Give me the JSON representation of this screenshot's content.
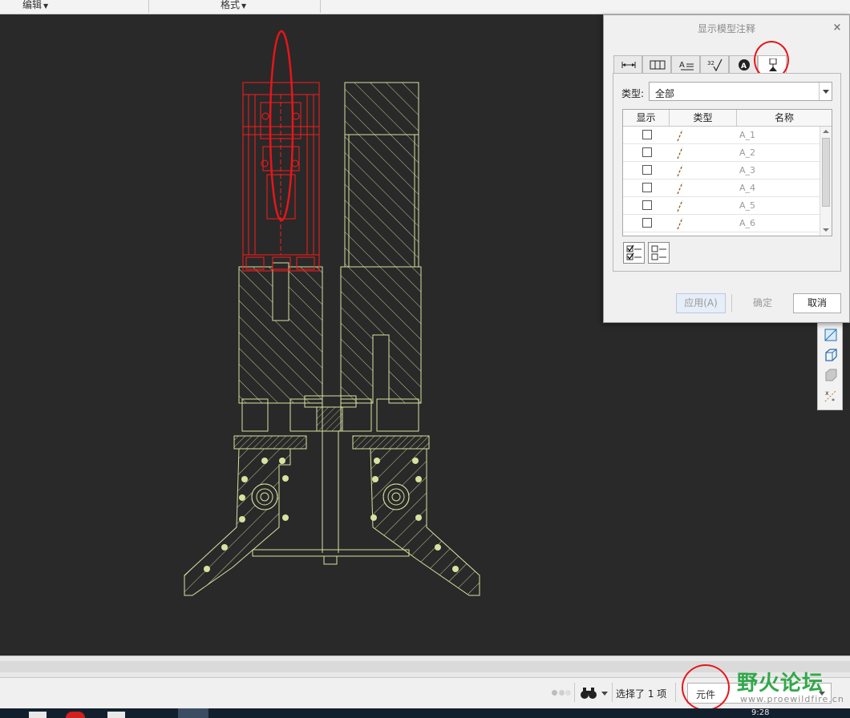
{
  "ribbon": {
    "groups": [
      {
        "label": "编辑"
      },
      {
        "label": "格式"
      }
    ]
  },
  "dialog": {
    "title": "显示模型注释",
    "close_glyph": "×",
    "tabs": [
      {
        "icon": "dimension-icon",
        "active": false
      },
      {
        "icon": "gtol-icon",
        "active": false
      },
      {
        "icon": "note-icon",
        "active": false
      },
      {
        "icon": "surface-finish-icon",
        "active": false
      },
      {
        "icon": "symbol-icon",
        "active": false
      },
      {
        "icon": "datum-target-icon",
        "active": true
      }
    ],
    "type_label": "类型:",
    "type_value": "全部",
    "columns": [
      "显示",
      "类型",
      "名称"
    ],
    "rows": [
      {
        "shown": false,
        "type_icon": "axis-line-icon",
        "name": "A_1"
      },
      {
        "shown": false,
        "type_icon": "axis-line-icon",
        "name": "A_2"
      },
      {
        "shown": false,
        "type_icon": "axis-line-icon",
        "name": "A_3"
      },
      {
        "shown": false,
        "type_icon": "axis-line-icon",
        "name": "A_4"
      },
      {
        "shown": false,
        "type_icon": "axis-line-icon",
        "name": "A_5"
      },
      {
        "shown": false,
        "type_icon": "axis-line-icon",
        "name": "A_6"
      }
    ],
    "select_all_icon": "select-all-icon",
    "deselect_all_icon": "deselect-all-icon",
    "buttons": {
      "apply": "应用(A)",
      "ok": "确定",
      "cancel": "取消"
    }
  },
  "side_toolbar": [
    "section-view-icon",
    "box-view-icon",
    "shaded-view-icon",
    "datum-display-icon"
  ],
  "status": {
    "selected_text": "选择了 1 项",
    "filter_value": "元件"
  },
  "watermark": {
    "title": "野火论坛",
    "url": "www.proewildfire.cn"
  },
  "taskbar": {
    "clock": "9:28"
  },
  "colors": {
    "model_line": "#d6e3a0",
    "highlight": "#ff1a1a",
    "annotation_ring": "#e8151a",
    "background": "#292929"
  }
}
